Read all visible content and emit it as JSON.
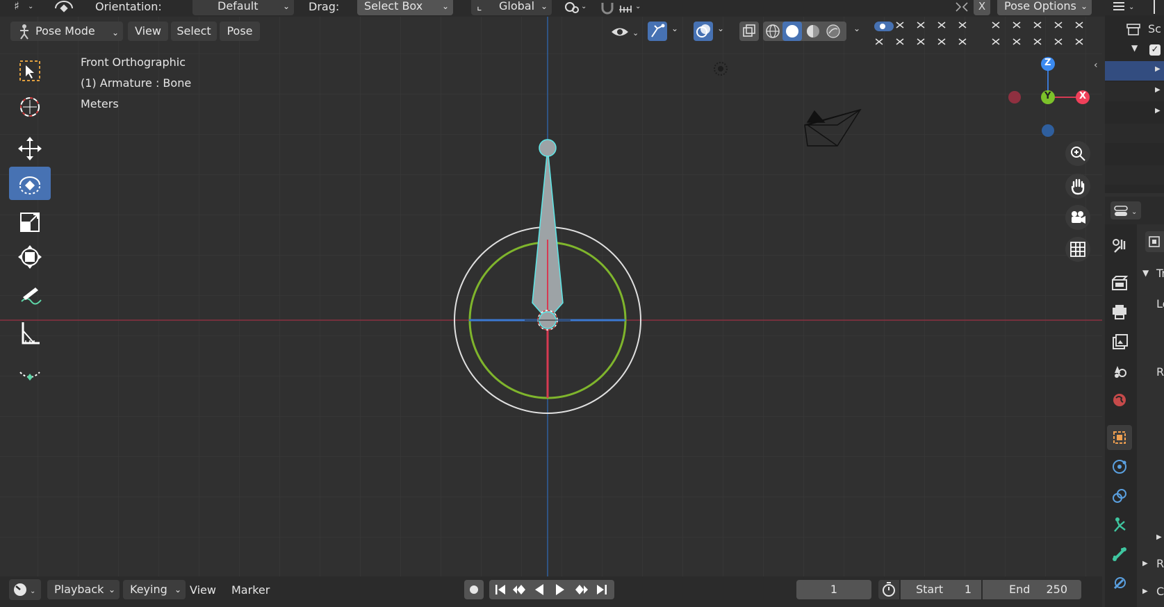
{
  "header": {
    "orientation_label": "Orientation:",
    "orientation_value": "Default",
    "drag_label": "Drag:",
    "drag_value": "Select Box",
    "transform_space": "Global",
    "pose_options": "Pose Options"
  },
  "viewport_header": {
    "mode": "Pose Mode",
    "menus": [
      "View",
      "Select",
      "Pose"
    ]
  },
  "viewport_info": {
    "view_name": "Front Orthographic",
    "object_info": "(1) Armature : Bone",
    "units": "Meters"
  },
  "nav_gizmo": {
    "z": "Z",
    "y": "Y",
    "x": "X"
  },
  "outliner": {
    "scene_fragment": "Sc"
  },
  "properties": {
    "panel_fragments": [
      "Tr",
      "Lo",
      "R",
      "R",
      "C"
    ]
  },
  "timeline": {
    "menus": [
      "Playback",
      "Keying",
      "View",
      "Marker"
    ],
    "current_frame": "1",
    "start_label": "Start",
    "start_value": "1",
    "end_label": "End",
    "end_value": "250"
  },
  "colors": {
    "accent": "#4772b3",
    "bone_fill": "#9da3a6",
    "bone_outline": "#5ee8e8",
    "x_axis": "#c43a4d",
    "z_axis": "#3b78d1",
    "y_gizmo": "#7cc22a",
    "rotate_ring": "#7fb52c"
  }
}
